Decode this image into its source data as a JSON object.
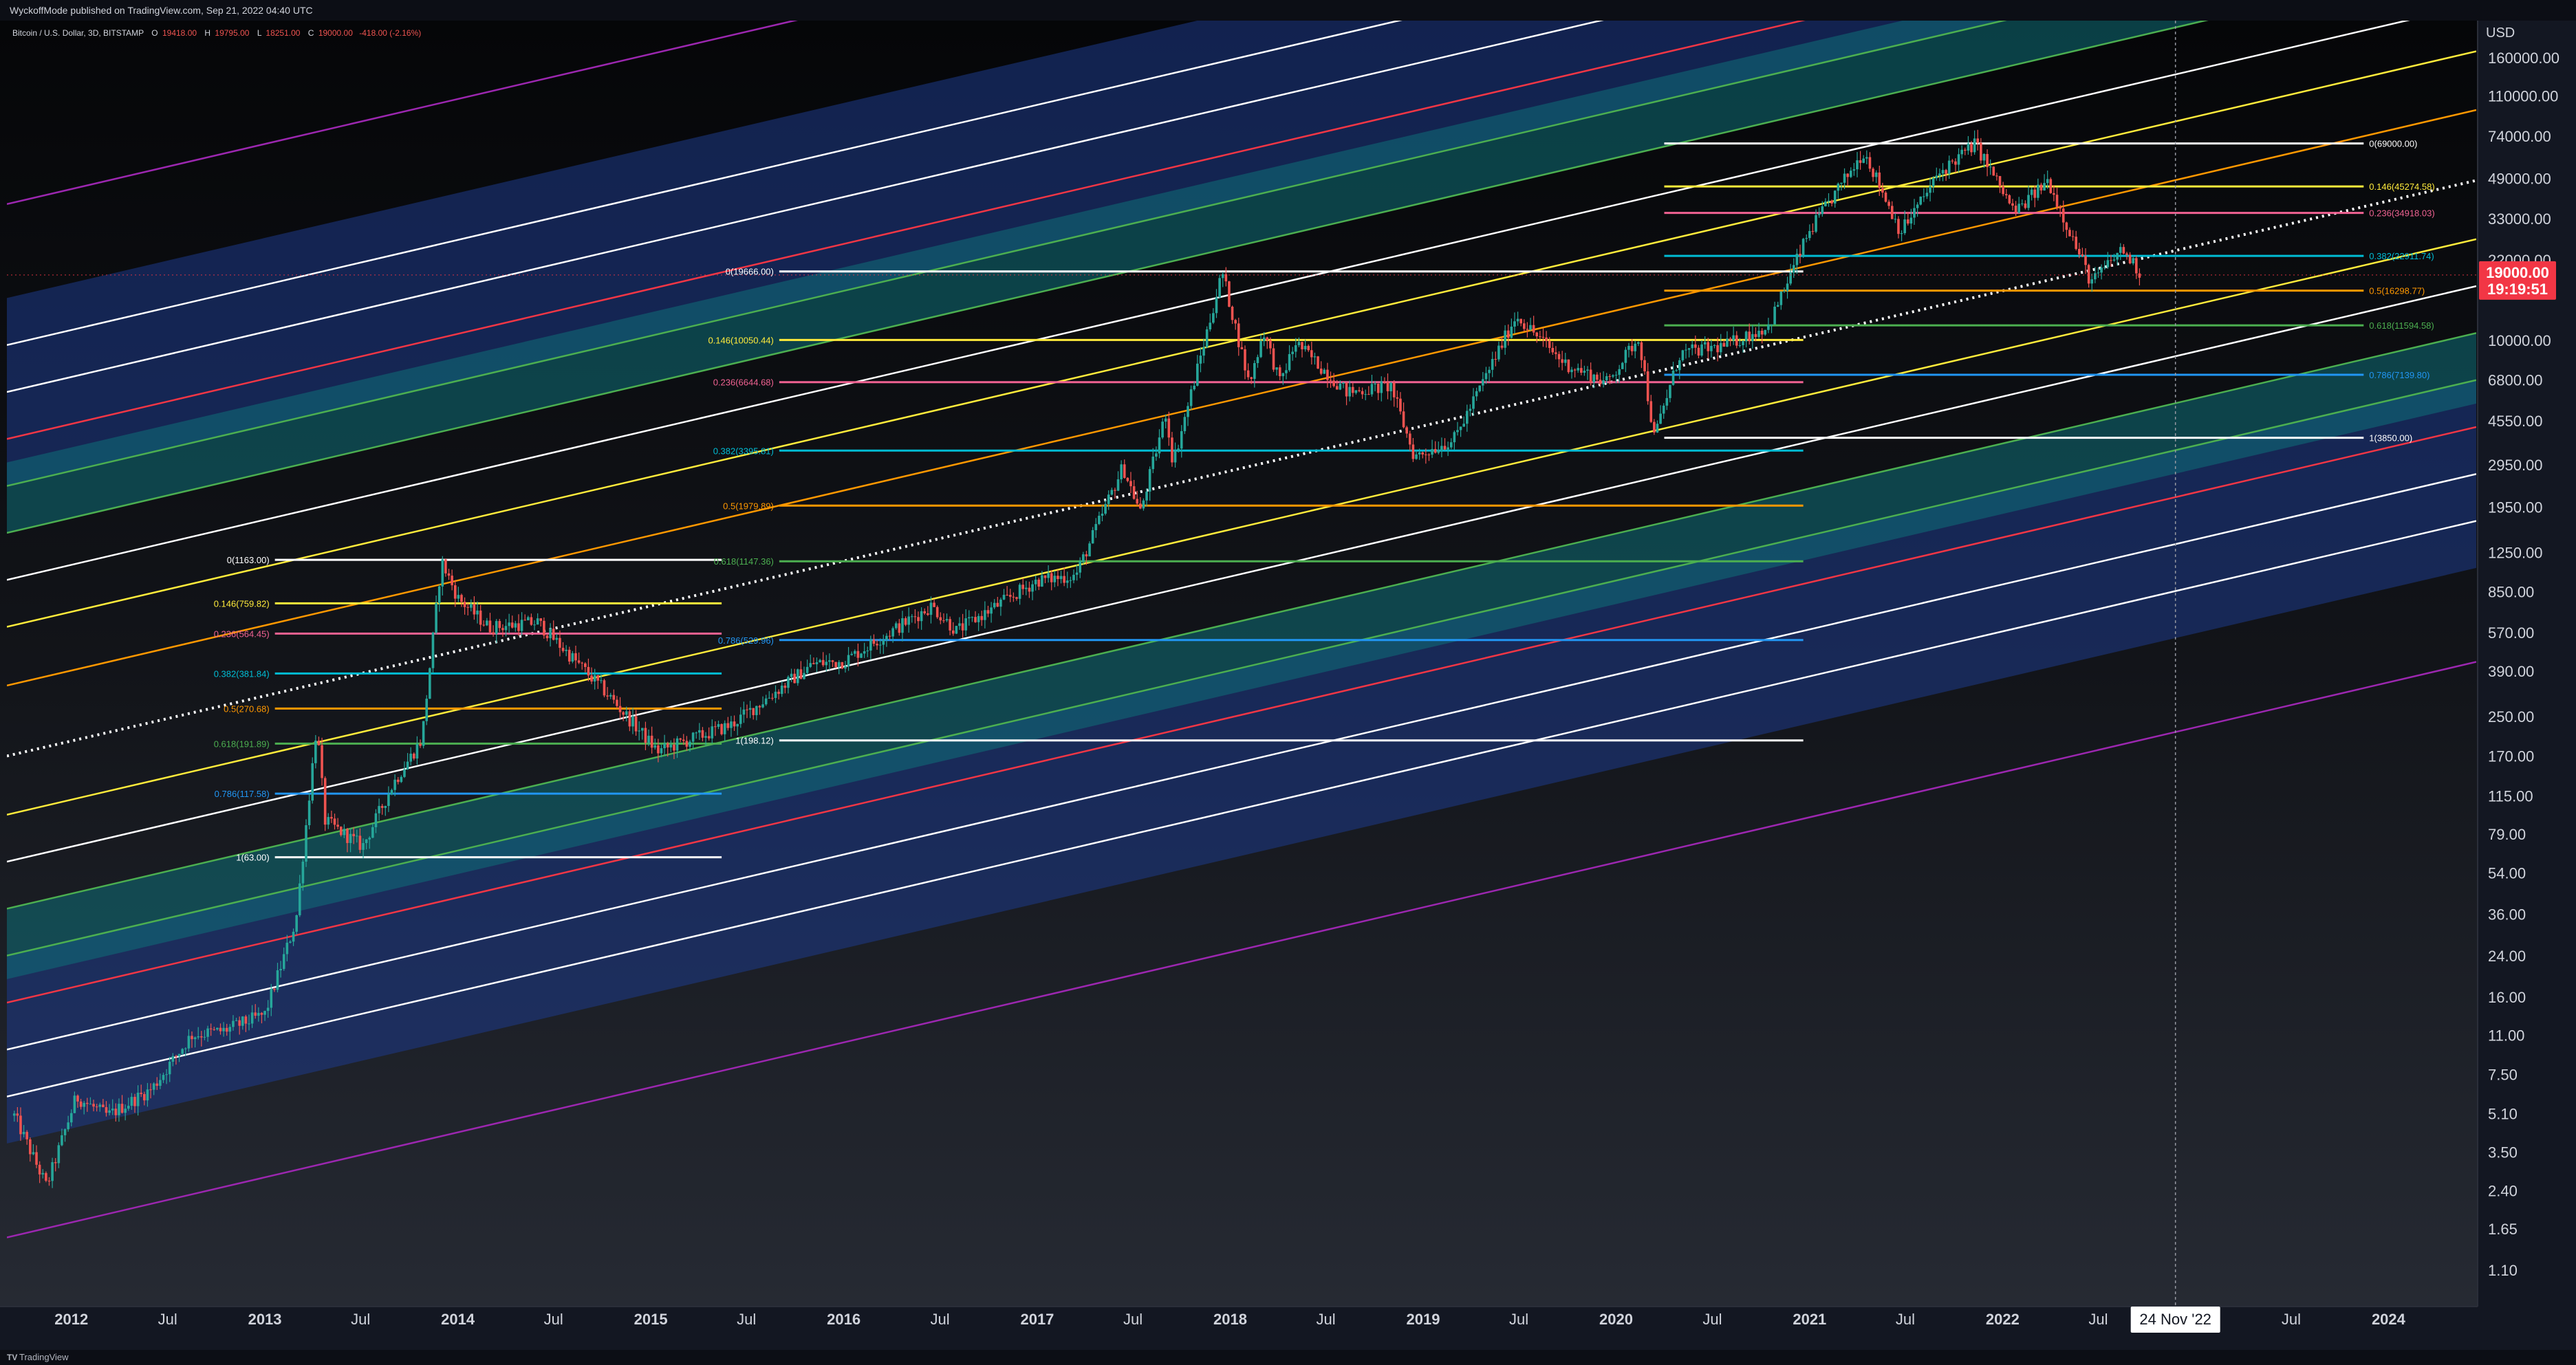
{
  "header": {
    "published": "WyckoffMode published on TradingView.com, Sep 21, 2022 04:40 UTC",
    "symbol": "Bitcoin / U.S. Dollar, 3D, BITSTAMP",
    "ohlc": {
      "o_label": "O",
      "o_value": "19418.00",
      "h_label": "H",
      "h_value": "19795.00",
      "l_label": "L",
      "l_value": "18251.00",
      "c_label": "C",
      "c_value": "19000.00",
      "change": "-418.00 (-2.16%)"
    }
  },
  "price_tag": {
    "price": "19000.00",
    "countdown": "19:19:51",
    "color": "#f23645"
  },
  "crosshair_date": "24 Nov '22",
  "footer": {
    "logo": "TV",
    "brand": "TradingView"
  },
  "colors": {
    "background": "#131722",
    "bull": "#26a69a",
    "bear": "#ef5350",
    "band_blue": "#1e3a8a",
    "band_teal": "#0f6f78",
    "purple": "#9c27b0",
    "white": "#ffffff",
    "red": "#f23645",
    "green": "#4caf50",
    "yellow": "#ffeb3b",
    "orange": "#ff9800",
    "cyan": "#00bcd4",
    "blue": "#2196f3",
    "pink": "#f06292"
  },
  "chart_data": {
    "type": "candlestick",
    "y_scale": "log",
    "y_unit": "USD",
    "y_ticks": [
      {
        "v": 160000,
        "label": "160000.00"
      },
      {
        "v": 110000,
        "label": "110000.00"
      },
      {
        "v": 74000,
        "label": "74000.00"
      },
      {
        "v": 49000,
        "label": "49000.00"
      },
      {
        "v": 33000,
        "label": "33000.00"
      },
      {
        "v": 22000,
        "label": "22000.00"
      },
      {
        "v": 10000,
        "label": "10000.00"
      },
      {
        "v": 6800,
        "label": "6800.00"
      },
      {
        "v": 4550,
        "label": "4550.00"
      },
      {
        "v": 2950,
        "label": "2950.00"
      },
      {
        "v": 1950,
        "label": "1950.00"
      },
      {
        "v": 1250,
        "label": "1250.00"
      },
      {
        "v": 850,
        "label": "850.00"
      },
      {
        "v": 570,
        "label": "570.00"
      },
      {
        "v": 390,
        "label": "390.00"
      },
      {
        "v": 250,
        "label": "250.00"
      },
      {
        "v": 170,
        "label": "170.00"
      },
      {
        "v": 115,
        "label": "115.00"
      },
      {
        "v": 79,
        "label": "79.00"
      },
      {
        "v": 54,
        "label": "54.00"
      },
      {
        "v": 36,
        "label": "36.00"
      },
      {
        "v": 24,
        "label": "24.00"
      },
      {
        "v": 16,
        "label": "16.00"
      },
      {
        "v": 11,
        "label": "11.00"
      },
      {
        "v": 7.5,
        "label": "7.50"
      },
      {
        "v": 5.1,
        "label": "5.10"
      },
      {
        "v": 3.5,
        "label": "3.50"
      },
      {
        "v": 2.4,
        "label": "2.40"
      },
      {
        "v": 1.65,
        "label": "1.65"
      },
      {
        "v": 1.1,
        "label": "1.10"
      }
    ],
    "x_range": [
      "2011-09-01",
      "2024-06-15"
    ],
    "x_ticks": [
      {
        "d": "2012-01-01",
        "label": "2012",
        "major": true
      },
      {
        "d": "2012-07-01",
        "label": "Jul",
        "major": false
      },
      {
        "d": "2013-01-01",
        "label": "2013",
        "major": true
      },
      {
        "d": "2013-07-01",
        "label": "Jul",
        "major": false
      },
      {
        "d": "2014-01-01",
        "label": "2014",
        "major": true
      },
      {
        "d": "2014-07-01",
        "label": "Jul",
        "major": false
      },
      {
        "d": "2015-01-01",
        "label": "2015",
        "major": true
      },
      {
        "d": "2015-07-01",
        "label": "Jul",
        "major": false
      },
      {
        "d": "2016-01-01",
        "label": "2016",
        "major": true
      },
      {
        "d": "2016-07-01",
        "label": "Jul",
        "major": false
      },
      {
        "d": "2017-01-01",
        "label": "2017",
        "major": true
      },
      {
        "d": "2017-07-01",
        "label": "Jul",
        "major": false
      },
      {
        "d": "2018-01-01",
        "label": "2018",
        "major": true
      },
      {
        "d": "2018-07-01",
        "label": "Jul",
        "major": false
      },
      {
        "d": "2019-01-01",
        "label": "2019",
        "major": true
      },
      {
        "d": "2019-07-01",
        "label": "Jul",
        "major": false
      },
      {
        "d": "2020-01-01",
        "label": "2020",
        "major": true
      },
      {
        "d": "2020-07-01",
        "label": "Jul",
        "major": false
      },
      {
        "d": "2021-01-01",
        "label": "2021",
        "major": true
      },
      {
        "d": "2021-07-01",
        "label": "Jul",
        "major": false
      },
      {
        "d": "2022-01-01",
        "label": "2022",
        "major": true
      },
      {
        "d": "2022-07-01",
        "label": "Jul",
        "major": false
      },
      {
        "d": "2023-07-01",
        "label": "Jul",
        "major": false
      },
      {
        "d": "2024-01-01",
        "label": "2024",
        "major": true
      }
    ],
    "crosshair": {
      "d": "2022-11-24",
      "label": "24 Nov '22"
    },
    "last_price": 19000,
    "price_path": [
      [
        "2011-09-15",
        5
      ],
      [
        "2011-11-15",
        2.5
      ],
      [
        "2012-01-10",
        6
      ],
      [
        "2012-03-10",
        5
      ],
      [
        "2012-06-01",
        6.5
      ],
      [
        "2012-08-15",
        11
      ],
      [
        "2012-10-15",
        11.5
      ],
      [
        "2013-01-01",
        13.5
      ],
      [
        "2013-03-01",
        34
      ],
      [
        "2013-04-09",
        230
      ],
      [
        "2013-04-25",
        90
      ],
      [
        "2013-07-05",
        70
      ],
      [
        "2013-09-01",
        130
      ],
      [
        "2013-10-25",
        200
      ],
      [
        "2013-12-01",
        1150
      ],
      [
        "2014-01-01",
        800
      ],
      [
        "2014-03-01",
        600
      ],
      [
        "2014-06-01",
        630
      ],
      [
        "2014-10-01",
        330
      ],
      [
        "2015-01-14",
        178
      ],
      [
        "2015-06-01",
        230
      ],
      [
        "2015-11-04",
        420
      ],
      [
        "2016-01-01",
        430
      ],
      [
        "2016-06-15",
        740
      ],
      [
        "2016-08-01",
        580
      ],
      [
        "2017-01-01",
        950
      ],
      [
        "2017-03-15",
        1000
      ],
      [
        "2017-06-12",
        2900
      ],
      [
        "2017-07-15",
        1850
      ],
      [
        "2017-09-01",
        4900
      ],
      [
        "2017-09-15",
        3000
      ],
      [
        "2017-12-17",
        19500
      ],
      [
        "2018-02-06",
        6500
      ],
      [
        "2018-03-05",
        11000
      ],
      [
        "2018-04-05",
        6600
      ],
      [
        "2018-05-05",
        9800
      ],
      [
        "2018-08-10",
        6000
      ],
      [
        "2018-11-01",
        6400
      ],
      [
        "2018-12-15",
        3200
      ],
      [
        "2019-03-01",
        3800
      ],
      [
        "2019-06-26",
        12800
      ],
      [
        "2019-09-25",
        8000
      ],
      [
        "2019-12-15",
        6600
      ],
      [
        "2020-02-13",
        10400
      ],
      [
        "2020-03-13",
        3850
      ],
      [
        "2020-05-01",
        8800
      ],
      [
        "2020-07-25",
        9500
      ],
      [
        "2020-10-15",
        11500
      ],
      [
        "2020-12-31",
        29000
      ],
      [
        "2021-04-14",
        64000
      ],
      [
        "2021-06-22",
        29000
      ],
      [
        "2021-09-05",
        52000
      ],
      [
        "2021-11-10",
        68900
      ],
      [
        "2022-01-24",
        35000
      ],
      [
        "2022-03-28",
        48000
      ],
      [
        "2022-06-18",
        17600
      ],
      [
        "2022-08-15",
        24500
      ],
      [
        "2022-09-21",
        19000
      ]
    ],
    "channel": {
      "p1": {
        "d": "2011-09-01",
        "v": 170
      },
      "p2": {
        "d": "2024-06-15",
        "v": 48000
      },
      "levels": [
        {
          "m": 2.35,
          "color": "#9c27b0"
        },
        {
          "m": 1.75,
          "color": "#ffffff"
        },
        {
          "m": 1.55,
          "color": "#ffffff"
        },
        {
          "m": 1.35,
          "color": "#f23645"
        },
        {
          "m": 1.15,
          "color": "#4caf50"
        },
        {
          "m": 0.95,
          "color": "#4caf50"
        },
        {
          "m": 0.75,
          "color": "#ffffff"
        },
        {
          "m": 0.55,
          "color": "#ffeb3b"
        },
        {
          "m": 0.3,
          "color": "#ff9800"
        },
        {
          "m": 0.0,
          "color": "#ffffff",
          "dotted": true
        },
        {
          "m": -0.25,
          "color": "#ffeb3b"
        },
        {
          "m": -0.45,
          "color": "#ffffff"
        },
        {
          "m": -0.65,
          "color": "#4caf50"
        },
        {
          "m": -0.85,
          "color": "#4caf50"
        },
        {
          "m": -1.05,
          "color": "#f23645"
        },
        {
          "m": -1.25,
          "color": "#ffffff"
        },
        {
          "m": -1.45,
          "color": "#ffffff"
        },
        {
          "m": -2.05,
          "color": "#9c27b0"
        }
      ],
      "bands": [
        {
          "from": 1.15,
          "to": 1.95,
          "color": "#1e3a8a"
        },
        {
          "from": 0.95,
          "to": 1.25,
          "color": "#0f6f78"
        },
        {
          "from": -1.65,
          "to": -0.85,
          "color": "#1e3a8a"
        },
        {
          "from": -0.95,
          "to": -0.65,
          "color": "#0f6f78"
        }
      ]
    },
    "fib_sets": [
      {
        "name": "fib-2013",
        "x_start": "2013-01-20",
        "x_end": "2015-05-15",
        "label_align": "right",
        "levels": [
          {
            "label": "0(1163.00)",
            "v": 1163,
            "color": "#ffffff"
          },
          {
            "label": "0.146(759.82)",
            "v": 759.82,
            "color": "#ffeb3b"
          },
          {
            "label": "0.236(564.45)",
            "v": 564.45,
            "color": "#f06292"
          },
          {
            "label": "0.382(381.84)",
            "v": 381.84,
            "color": "#00bcd4"
          },
          {
            "label": "0.5(270.68)",
            "v": 270.68,
            "color": "#ff9800"
          },
          {
            "label": "0.618(191.89)",
            "v": 191.89,
            "color": "#4caf50"
          },
          {
            "label": "0.786(117.58)",
            "v": 117.58,
            "color": "#2196f3"
          },
          {
            "label": "1(63.00)",
            "v": 63,
            "color": "#ffffff"
          }
        ]
      },
      {
        "name": "fib-2017",
        "x_start": "2015-09-01",
        "x_end": "2020-12-20",
        "label_align": "right",
        "levels": [
          {
            "label": "0(19666.00)",
            "v": 19666,
            "color": "#ffffff"
          },
          {
            "label": "0.146(10050.44)",
            "v": 10050.44,
            "color": "#ffeb3b"
          },
          {
            "label": "0.236(6644.68)",
            "v": 6644.68,
            "color": "#f06292"
          },
          {
            "label": "0.382(3395.81)",
            "v": 3395.81,
            "color": "#00bcd4"
          },
          {
            "label": "0.5(1979.89)",
            "v": 1979.89,
            "color": "#ff9800"
          },
          {
            "label": "0.618(1147.36)",
            "v": 1147.36,
            "color": "#4caf50"
          },
          {
            "label": "0.786(529.96)",
            "v": 529.96,
            "color": "#2196f3"
          },
          {
            "label": "1(198.12)",
            "v": 198.12,
            "color": "#ffffff"
          }
        ]
      },
      {
        "name": "fib-2021",
        "x_start": "2020-04-01",
        "x_end": "2023-11-15",
        "label_align": "left",
        "levels": [
          {
            "label": "0(69000.00)",
            "v": 69000,
            "color": "#ffffff"
          },
          {
            "label": "0.146(45274.58)",
            "v": 45274.58,
            "color": "#ffeb3b"
          },
          {
            "label": "0.236(34918.03)",
            "v": 34918.03,
            "color": "#f06292"
          },
          {
            "label": "0.382(22911.74)",
            "v": 22911.74,
            "color": "#00bcd4"
          },
          {
            "label": "0.5(16298.77)",
            "v": 16298.77,
            "color": "#ff9800"
          },
          {
            "label": "0.618(11594.58)",
            "v": 11594.58,
            "color": "#4caf50"
          },
          {
            "label": "0.786(7139.80)",
            "v": 7139.8,
            "color": "#2196f3"
          },
          {
            "label": "1(3850.00)",
            "v": 3850,
            "color": "#ffffff"
          }
        ]
      }
    ]
  }
}
